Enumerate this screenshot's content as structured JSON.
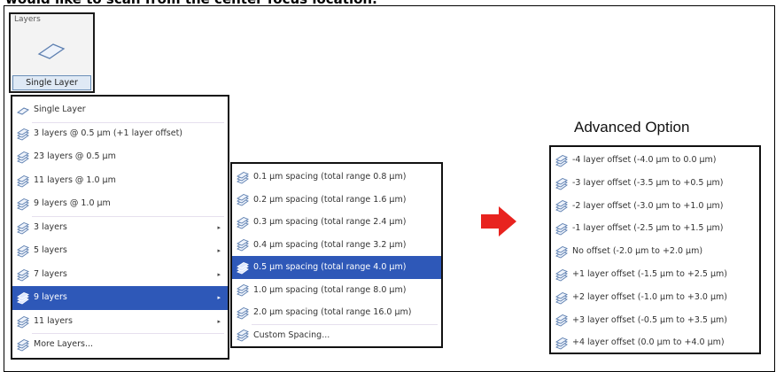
{
  "caption": "would like to scan from the center focus location.",
  "layers_group": {
    "title": "Layers",
    "button_label": "Single Layer"
  },
  "main_menu": {
    "items": [
      {
        "label": "Single Layer",
        "icon": "single-layer-icon",
        "submenu": false,
        "highlighted": false
      },
      {
        "label": "3 layers @ 0.5 µm (+1 layer offset)",
        "icon": "layer-stack-icon",
        "submenu": false,
        "highlighted": false
      },
      {
        "label": "23 layers @ 0.5 µm",
        "icon": "layer-stack-icon",
        "submenu": false,
        "highlighted": false
      },
      {
        "label": "11 layers @ 1.0 µm",
        "icon": "layer-stack-icon",
        "submenu": false,
        "highlighted": false
      },
      {
        "label": "9 layers @ 1.0 µm",
        "icon": "layer-stack-icon",
        "submenu": false,
        "highlighted": false
      },
      {
        "label": "3 layers",
        "icon": "layer-stack-icon",
        "submenu": true,
        "highlighted": false
      },
      {
        "label": "5 layers",
        "icon": "layer-stack-icon",
        "submenu": true,
        "highlighted": false
      },
      {
        "label": "7 layers",
        "icon": "layer-stack-icon",
        "submenu": true,
        "highlighted": false
      },
      {
        "label": "9 layers",
        "icon": "layer-stack-icon",
        "submenu": true,
        "highlighted": true
      },
      {
        "label": "11 layers",
        "icon": "layer-stack-icon",
        "submenu": true,
        "highlighted": false
      },
      {
        "label": "More Layers...",
        "icon": "layer-stack-icon",
        "submenu": false,
        "highlighted": false
      }
    ]
  },
  "spacing_menu": {
    "items": [
      {
        "label": "0.1 µm spacing (total range 0.8 µm)",
        "highlighted": false
      },
      {
        "label": "0.2 µm spacing (total range 1.6 µm)",
        "highlighted": false
      },
      {
        "label": "0.3 µm spacing (total range 2.4 µm)",
        "highlighted": false
      },
      {
        "label": "0.4 µm spacing (total range 3.2 µm)",
        "highlighted": false
      },
      {
        "label": "0.5 µm spacing (total range 4.0 µm)",
        "highlighted": true
      },
      {
        "label": "1.0 µm spacing (total range 8.0 µm)",
        "highlighted": false
      },
      {
        "label": "2.0 µm spacing (total range 16.0 µm)",
        "highlighted": false
      },
      {
        "label": "Custom Spacing...",
        "highlighted": false
      }
    ]
  },
  "advanced": {
    "title": "Advanced Option",
    "items": [
      {
        "label": "-4 layer offset (-4.0 µm to 0.0 µm)"
      },
      {
        "label": "-3 layer offset (-3.5 µm to +0.5 µm)"
      },
      {
        "label": "-2 layer offset (-3.0 µm to +1.0 µm)"
      },
      {
        "label": "-1 layer offset (-2.5 µm to +1.5 µm)"
      },
      {
        "label": "No offset (-2.0 µm to +2.0 µm)"
      },
      {
        "label": "+1 layer offset (-1.5 µm to +2.5 µm)"
      },
      {
        "label": "+2 layer offset (-1.0 µm to +3.0 µm)"
      },
      {
        "label": "+3 layer offset (-0.5 µm to +3.5 µm)"
      },
      {
        "label": "+4 layer offset (0.0 µm to +4.0 µm)"
      }
    ]
  },
  "colors": {
    "highlight": "#2e58b8",
    "arrow": "#e8231f"
  }
}
